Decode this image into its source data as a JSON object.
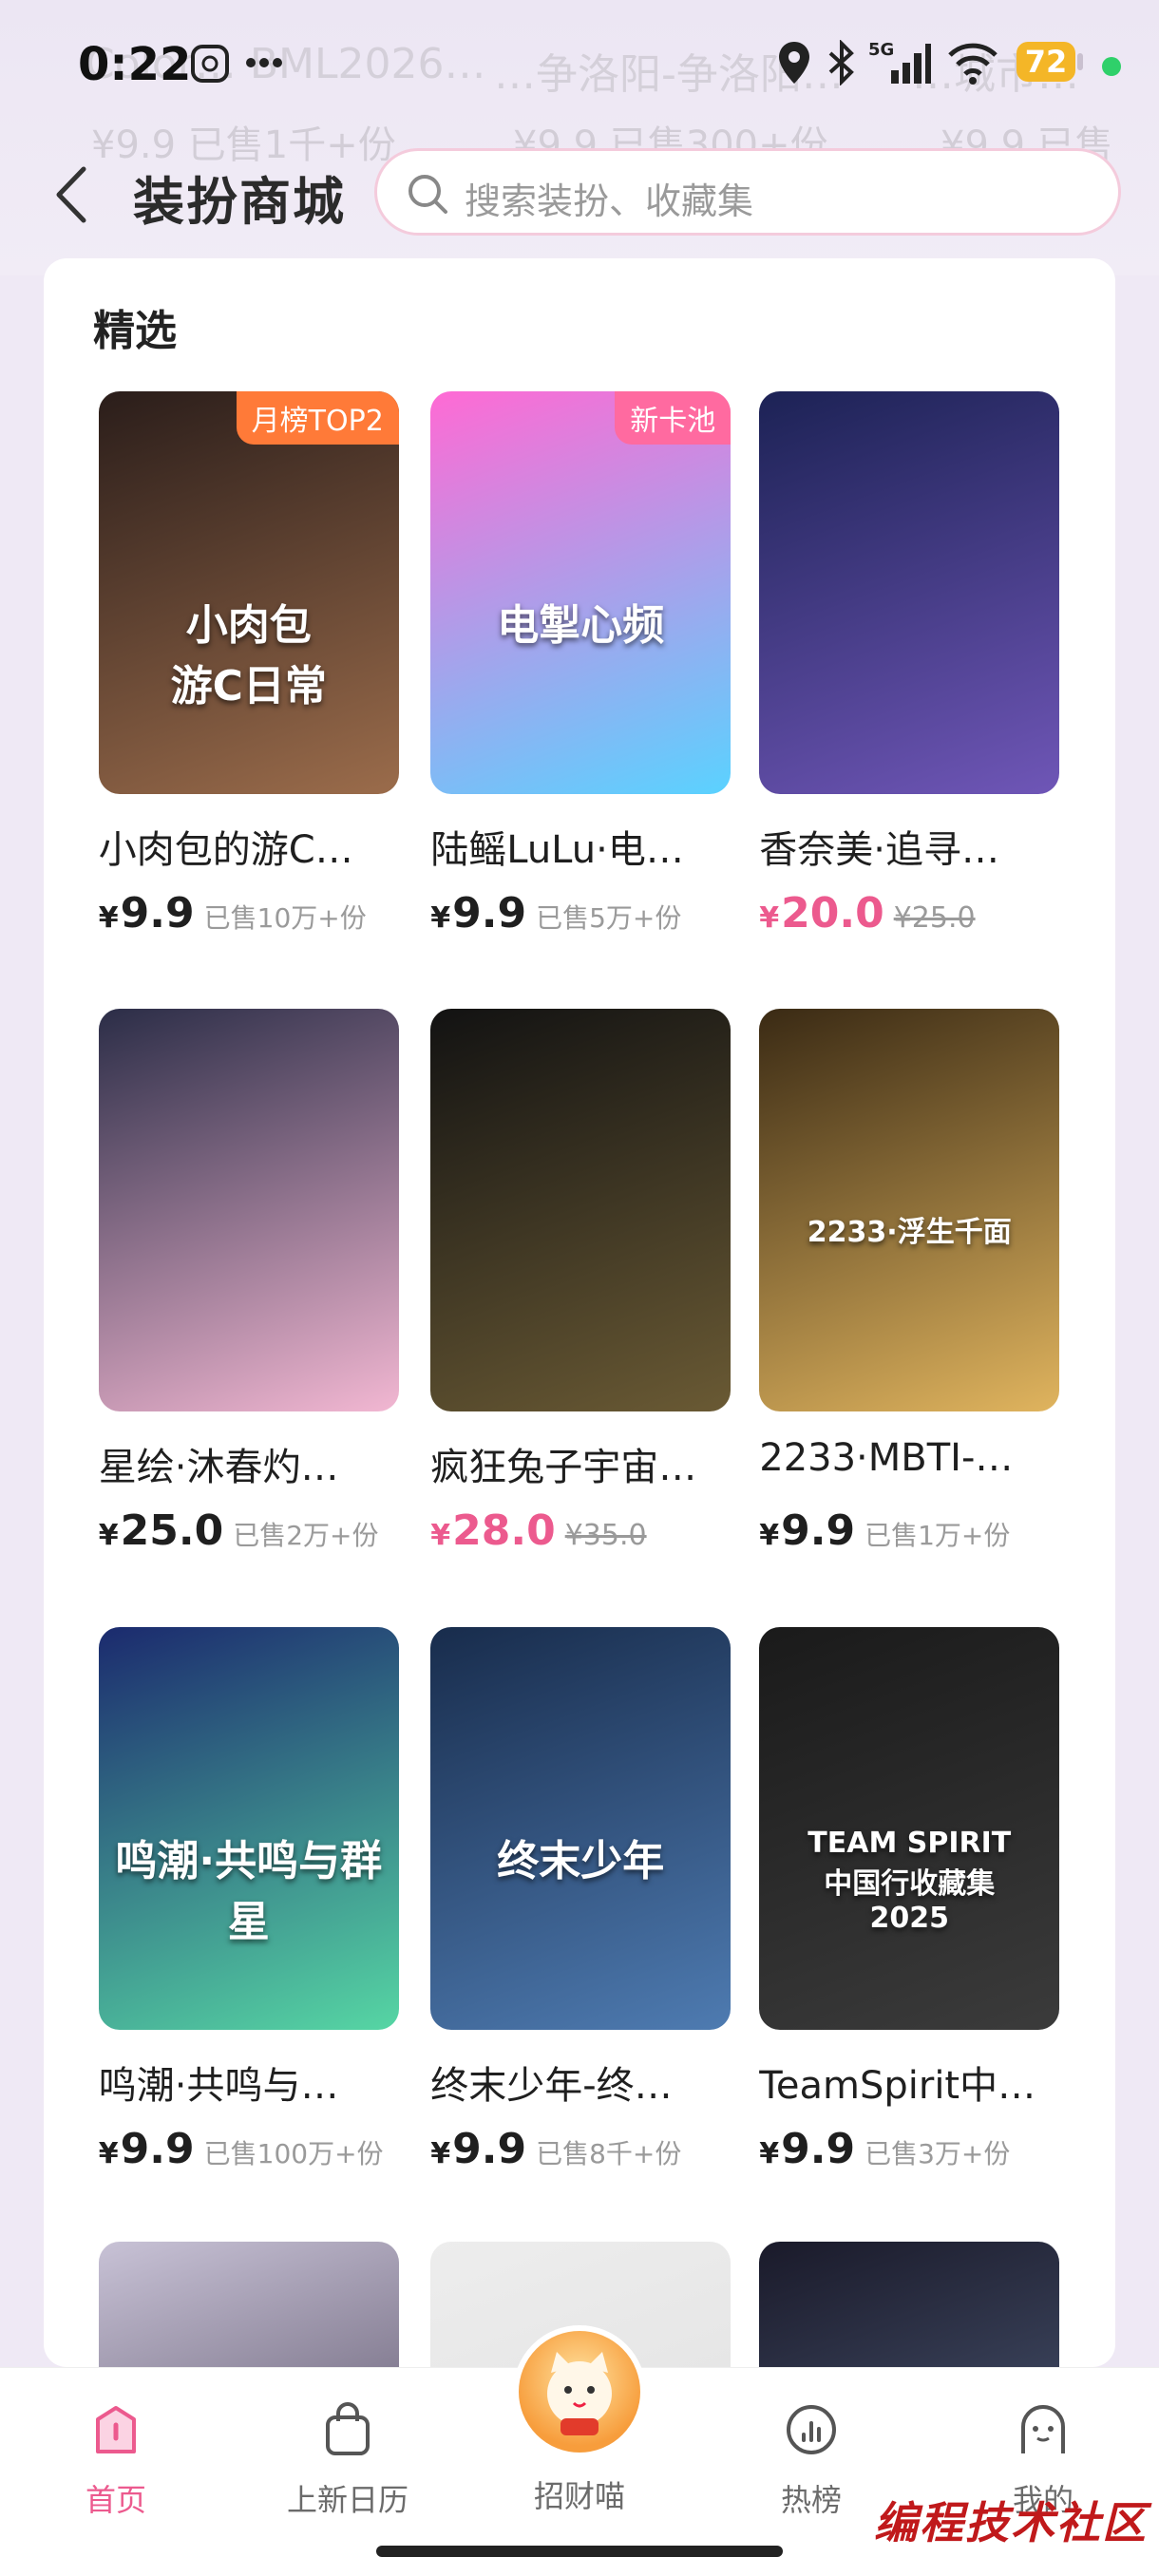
{
  "ghost_header": {
    "titles": [
      "Color… BML2026…",
      "…争洛阳-争洛阳…",
      "…城市…"
    ],
    "prices": [
      "¥9.9 已售1千+份",
      "¥9.9 已售300+份",
      "¥9.9 已售1…"
    ]
  },
  "status_bar": {
    "time": "0:22",
    "battery": "72",
    "icons": [
      "app-notification-icon",
      "more-icon",
      "location-icon",
      "bluetooth-icon",
      "5g-signal-icon",
      "wifi-icon"
    ]
  },
  "nav": {
    "title": "装扮商城",
    "search_placeholder": "搜索装扮、收藏集"
  },
  "section": {
    "title": "精选"
  },
  "items": [
    {
      "title": "小肉包的游C…",
      "price": "9.9",
      "sold": "已售10万+份",
      "tag": "月榜TOP2",
      "art_text": "小肉包\n游C日常",
      "colors": [
        "#2a1d1a",
        "#9b6c4b"
      ],
      "price_pink": false,
      "orig": ""
    },
    {
      "title": "陆鳐LuLu·电…",
      "price": "9.9",
      "sold": "已售5万+份",
      "tag": "新卡池",
      "art_text": "电掣心频",
      "colors": [
        "#ff6ad4",
        "#5ad2ff"
      ],
      "price_pink": false,
      "orig": ""
    },
    {
      "title": "香奈美·追寻…",
      "price": "20.0",
      "sold": "",
      "tag": "",
      "art_text": "",
      "colors": [
        "#1c2255",
        "#6f56b7"
      ],
      "price_pink": true,
      "orig": "¥25.0"
    },
    {
      "title": "星绘·沐春灼…",
      "price": "25.0",
      "sold": "已售2万+份",
      "tag": "",
      "art_text": "",
      "colors": [
        "#2b2d47",
        "#f2b7d2"
      ],
      "price_pink": false,
      "orig": ""
    },
    {
      "title": "疯狂兔子宇宙…",
      "price": "28.0",
      "sold": "",
      "tag": "",
      "art_text": "",
      "colors": [
        "#121212",
        "#6a5a34"
      ],
      "price_pink": true,
      "orig": "¥35.0"
    },
    {
      "title": "2233·MBTI-…",
      "price": "9.9",
      "sold": "已售1万+份",
      "tag": "",
      "art_text": "2233·浮生千面",
      "colors": [
        "#3a2a14",
        "#e0b45e"
      ],
      "price_pink": false,
      "orig": ""
    },
    {
      "title": "鸣潮·共鸣与…",
      "price": "9.9",
      "sold": "已售100万+份",
      "tag": "",
      "art_text": "鸣潮·共鸣与群星",
      "colors": [
        "#1b2a6e",
        "#56d6a4"
      ],
      "price_pink": false,
      "orig": ""
    },
    {
      "title": "终末少年-终…",
      "price": "9.9",
      "sold": "已售8千+份",
      "tag": "",
      "art_text": "终末少年",
      "colors": [
        "#182c4c",
        "#4e7bb1"
      ],
      "price_pink": false,
      "orig": ""
    },
    {
      "title": "TeamSpirit中…",
      "price": "9.9",
      "sold": "已售3万+份",
      "tag": "",
      "art_text": "TEAM SPIRIT\n中国行收藏集\n2025",
      "colors": [
        "#1a1a1a",
        "#3b3b3b"
      ],
      "price_pink": false,
      "orig": ""
    },
    {
      "title": "",
      "price": "",
      "sold": "",
      "tag": "",
      "art_text": "",
      "colors": [
        "#c8c2d6",
        "#3a3148"
      ],
      "price_pink": false,
      "orig": ""
    },
    {
      "title": "",
      "price": "",
      "sold": "",
      "tag": "",
      "art_text": "",
      "colors": [
        "#ededed",
        "#dedede"
      ],
      "price_pink": false,
      "orig": ""
    },
    {
      "title": "",
      "price": "",
      "sold": "",
      "tag": "",
      "art_text": "",
      "colors": [
        "#1a1a2a",
        "#5a6a8a"
      ],
      "price_pink": false,
      "orig": ""
    }
  ],
  "bottom_nav": [
    {
      "label": "首页",
      "icon": "home-icon",
      "active": true
    },
    {
      "label": "上新日历",
      "icon": "bag-icon",
      "active": false
    },
    {
      "label": "招财喵",
      "icon": "lucky-cat-icon",
      "active": false
    },
    {
      "label": "热榜",
      "icon": "chart-icon",
      "active": false
    },
    {
      "label": "我的",
      "icon": "profile-icon",
      "active": false
    }
  ],
  "watermark": "编程技术社区",
  "accent_color": "#ec5a8e"
}
